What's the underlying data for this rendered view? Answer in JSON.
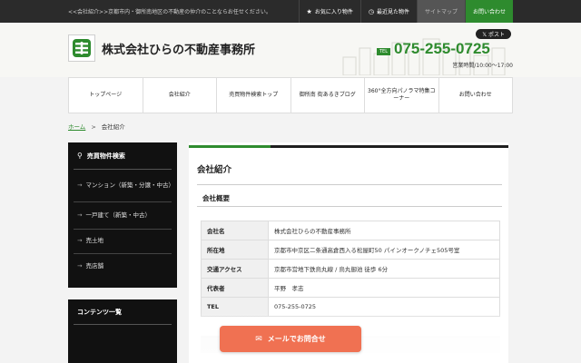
{
  "topbar": {
    "tagline": "<<会社紹介>>京都市内・御所南地区の不動産の仲介のことならお任せください。",
    "links": [
      {
        "label": "お気に入り物件",
        "icon": "star-icon"
      },
      {
        "label": "最近見た物件",
        "icon": "clock-icon"
      },
      {
        "label": "サイトマップ",
        "icon": ""
      },
      {
        "label": "お問い合わせ",
        "icon": ""
      }
    ]
  },
  "header": {
    "company": "株式会社ひらの不動産事務所",
    "xpost": "ポスト",
    "tel_badge": "TEL",
    "tel": "075-255-0725",
    "hours": "営業時間/10:00～17:00"
  },
  "mainnav": [
    "トップページ",
    "会社紹介",
    "売買物件検索トップ",
    "御所南 街あるきブログ",
    "360°全方向パノラマ特集コーナー",
    "お問い合わせ"
  ],
  "breadcrumb": {
    "home": "ホーム",
    "sep": ">",
    "current": "会社紹介"
  },
  "sidebar": {
    "search_title": "売買物件検索",
    "items": [
      "マンション（新築・分譲・中古）",
      "一戸建て（新築・中古）",
      "売土地",
      "売店舗"
    ],
    "contents_title": "コンテンツ一覧"
  },
  "content": {
    "title": "会社紹介",
    "subtitle": "会社概要",
    "rows": [
      {
        "k": "会社名",
        "v": "株式会社ひらの不動産事務所"
      },
      {
        "k": "所在地",
        "v": "京都市中京区二条通高倉西入る松屋町50 パインオークノチェ505号室"
      },
      {
        "k": "交通アクセス",
        "v": "京都市営地下鉄烏丸線 / 烏丸御池 徒歩 6分"
      },
      {
        "k": "代表者",
        "v": "平野　孝志"
      },
      {
        "k": "TEL",
        "v": "075-255-0725"
      }
    ]
  },
  "mail_button": "メールでお問合せ",
  "colors": {
    "accent": "#2e8b2e",
    "mail": "#f07152",
    "topbar": "#2b2b2b"
  }
}
